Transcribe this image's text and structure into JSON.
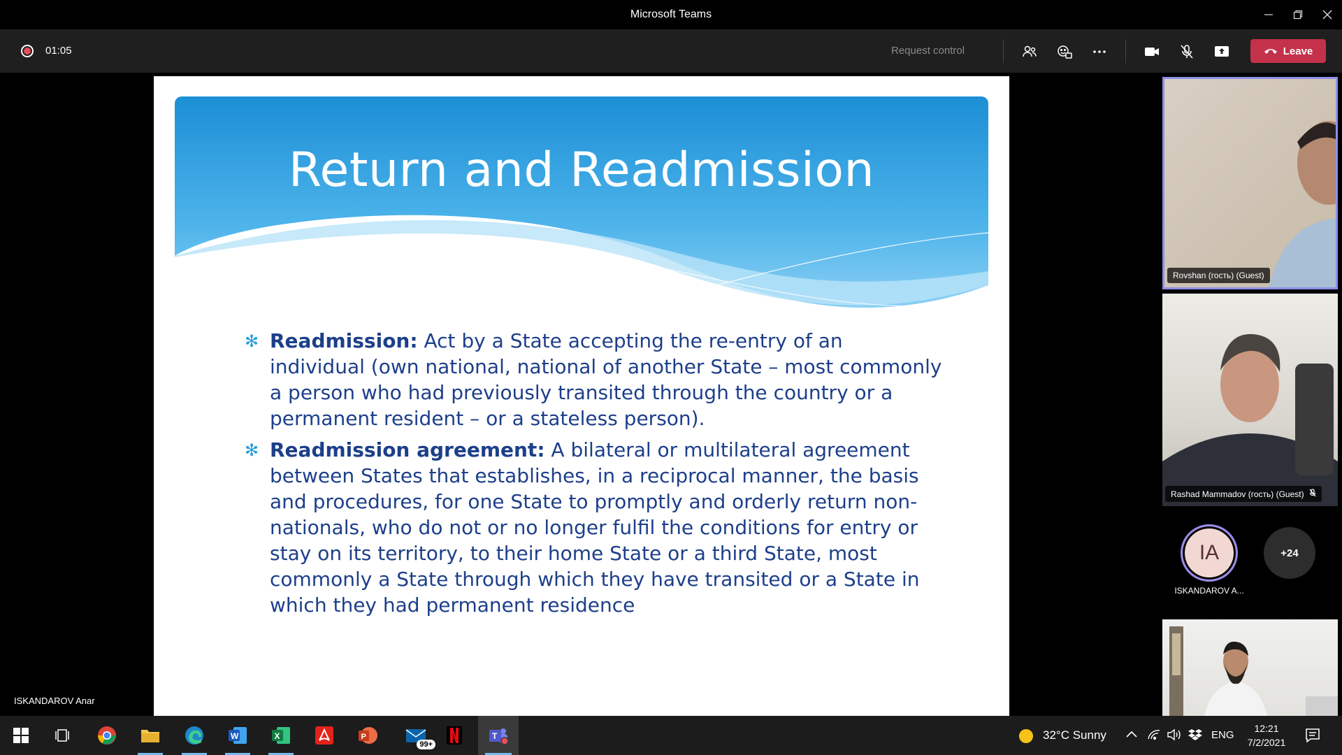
{
  "window": {
    "title": "Microsoft Teams",
    "minimize_icon": "minimize-icon",
    "restore_icon": "restore-icon",
    "close_icon": "close-icon"
  },
  "toolbar": {
    "recording_icon": "record-icon",
    "timer": "01:05",
    "request_control": "Request control",
    "icons": [
      "participants-icon",
      "reactions-icon",
      "more-icon",
      "camera-icon",
      "mic-off-icon",
      "share-icon"
    ],
    "leave_label": "Leave",
    "leave_color": "#c4314b"
  },
  "stage": {
    "presenter_name": "ISKANDAROV Anar"
  },
  "slide": {
    "title": "Return and Readmission",
    "bullets": [
      {
        "term": "Readmission:",
        "text": " Act by a State accepting the re-entry of an individual (own national, national of another State – most commonly a person who had previously transited through the country or a permanent resident – or a stateless person)."
      },
      {
        "term": "Readmission agreement:",
        "text": " A bilateral or multilateral agreement between States that establishes, in a reciprocal manner, the basis and procedures, for one State to promptly and orderly return non-nationals, who do not or no longer fulfil the conditions for entry or stay on its territory, to their home State or a third State, most commonly a State through which they have transited or a State in which they had permanent residence"
      }
    ],
    "header_color": "#2a9fd8",
    "text_color": "#1d3f8a"
  },
  "participants": {
    "tiles": [
      {
        "name": "Rovshan (гость) (Guest)"
      },
      {
        "name": "Rashad Mammadov (гость) (Guest)"
      }
    ],
    "avatar": {
      "initials": "IA",
      "name": "ISKANDAROV A..."
    },
    "more": "+24"
  },
  "taskbar": {
    "apps": [
      "windows-start-icon",
      "task-view-icon",
      "chrome-icon",
      "file-explorer-icon",
      "edge-icon",
      "word-icon",
      "excel-icon",
      "acrobat-icon",
      "powerpoint-icon",
      "mail-icon",
      "netflix-icon",
      "teams-icon"
    ],
    "mail_badge": "99+",
    "weather": "32°C  Sunny",
    "language": "ENG",
    "time": "12:21",
    "date": "7/2/2021"
  }
}
